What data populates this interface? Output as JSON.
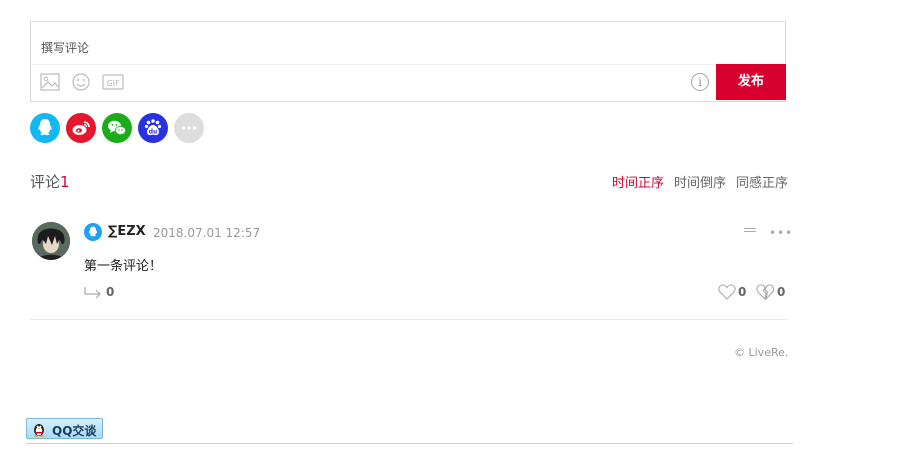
{
  "editor": {
    "placeholder": "撰写评论",
    "toolbar": {
      "image_icon": "image-icon",
      "emoji_icon": "emoji-icon",
      "gif_label": "GIF",
      "info_icon": "info-icon"
    },
    "publish_label": "发布"
  },
  "social_logins": [
    {
      "name": "qq",
      "icon": "qq-icon",
      "color": "#12b7f5"
    },
    {
      "name": "weibo",
      "icon": "weibo-icon",
      "color": "#e6162d"
    },
    {
      "name": "wechat",
      "icon": "wechat-icon",
      "color": "#1aad19"
    },
    {
      "name": "baidu",
      "icon": "baidu-icon",
      "color": "#2932e1"
    },
    {
      "name": "more",
      "icon": "more-icon",
      "color": "#dddddd"
    }
  ],
  "comments_header": {
    "title": "评论",
    "count": "1",
    "sort_options": [
      "时间正序",
      "时间倒序",
      "同感正序"
    ],
    "active_sort": "时间正序"
  },
  "comments": [
    {
      "user": "∑EZX",
      "platform_icon": "qq-icon",
      "time": "2018.07.01 12:57",
      "text": "第一条评论！",
      "reply_count": "0",
      "likes": "0",
      "dislikes": "0"
    }
  ],
  "footer": {
    "copyright": "© LiveRe."
  },
  "qq_chat": {
    "label": "QQ交谈"
  },
  "colors": {
    "accent": "#d7002f"
  }
}
